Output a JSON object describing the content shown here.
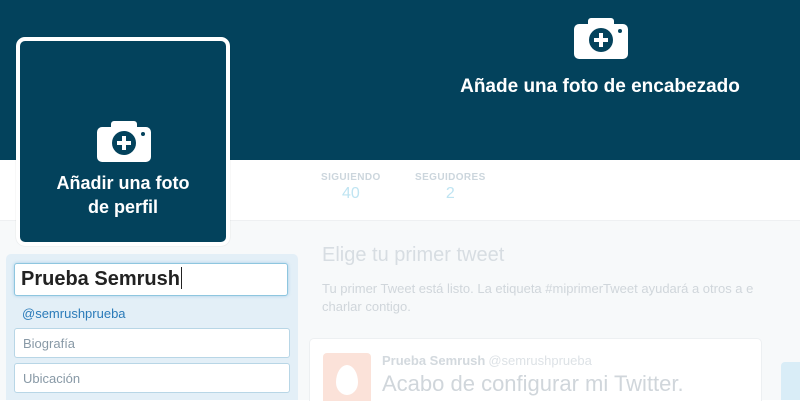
{
  "header": {
    "add_header_photo_label": "Añade una foto de encabezado"
  },
  "profile": {
    "add_profile_photo_line1": "Añadir una foto",
    "add_profile_photo_line2": "de perfil"
  },
  "stats": {
    "following_label": "SIGUIENDO",
    "following_value": "40",
    "followers_label": "SEGUIDORES",
    "followers_value": "2"
  },
  "edit_profile": {
    "name_value": "Prueba Semrush",
    "handle": "@semrushprueba",
    "bio_placeholder": "Biografía",
    "location_placeholder": "Ubicación"
  },
  "first_tweet": {
    "title": "Elige tu primer tweet",
    "description_line1": "Tu primer Tweet está listo. La etiqueta #miprimerTweet ayudará a otros a e",
    "description_line2": "charlar contigo.",
    "card": {
      "author_name": "Prueba Semrush",
      "author_handle": "@semrushprueba",
      "text": "Acabo de configurar mi Twitter."
    }
  },
  "colors": {
    "header_bg": "#03425c",
    "accent_link": "#2b7bb9",
    "edit_panel_bg": "#e3eff7"
  },
  "icons": {
    "header_photo": "camera-plus-icon",
    "profile_photo": "camera-plus-icon",
    "default_avatar": "egg-avatar-icon"
  }
}
